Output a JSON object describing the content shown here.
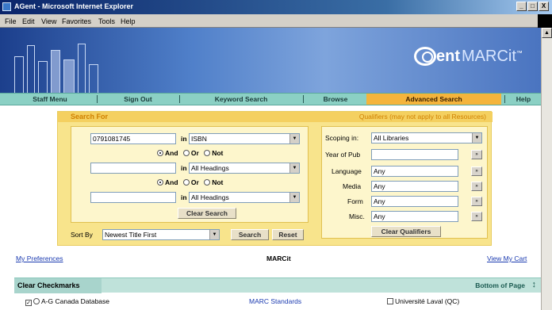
{
  "window": {
    "title": "AGent - Microsoft Internet Explorer",
    "buttons": [
      "_",
      "□",
      "X"
    ]
  },
  "menubar": [
    "File",
    "Edit",
    "View",
    "Favorites",
    "Tools",
    "Help"
  ],
  "logo": {
    "prefix": "AG",
    "word": "ent",
    "product": "MARCit",
    "tm": "™"
  },
  "nav": {
    "items": [
      "Staff Menu",
      "Sign Out",
      "Keyword Search",
      "Browse",
      "Advanced Search",
      "Help"
    ],
    "active": "Advanced Search",
    "active_color": "#f4b43c",
    "bar_color": "#8bd0c4"
  },
  "search": {
    "header": "Search For",
    "qualifiers_note": "Qualifiers (may not apply to all Resources)",
    "rows": [
      {
        "value": "0791081745",
        "in_label": "in",
        "field": "ISBN"
      },
      {
        "value": "",
        "in_label": "in",
        "field": "All Headings"
      },
      {
        "value": "",
        "in_label": "in",
        "field": "All Headings"
      }
    ],
    "boolean": {
      "and": "And",
      "or": "Or",
      "not": "Not"
    },
    "clear_search": "Clear Search",
    "sort_label": "Sort By",
    "sort_value": "Newest Title First",
    "search_button": "Search",
    "reset_button": "Reset"
  },
  "qualifiers": {
    "scoping_label": "Scoping in:",
    "scoping_value": "All Libraries",
    "year_label": "Year of Pub",
    "year_value": "",
    "language_label": "Language",
    "language_value": "Any",
    "media_label": "Media",
    "media_value": "Any",
    "form_label": "Form",
    "form_value": "Any",
    "misc_label": "Misc.",
    "misc_value": "Any",
    "clear_button": "Clear Qualifiers"
  },
  "links": {
    "preferences": "My Preferences",
    "center_title": "MARCit",
    "view_cart": "View My Cart"
  },
  "results": {
    "clear_checkmarks": "Clear Checkmarks",
    "bottom_of_page": "Bottom of Page",
    "row": {
      "database": "A-G Canada Database",
      "standards": "MARC Standards",
      "library": "Université Laval (QC)"
    }
  }
}
